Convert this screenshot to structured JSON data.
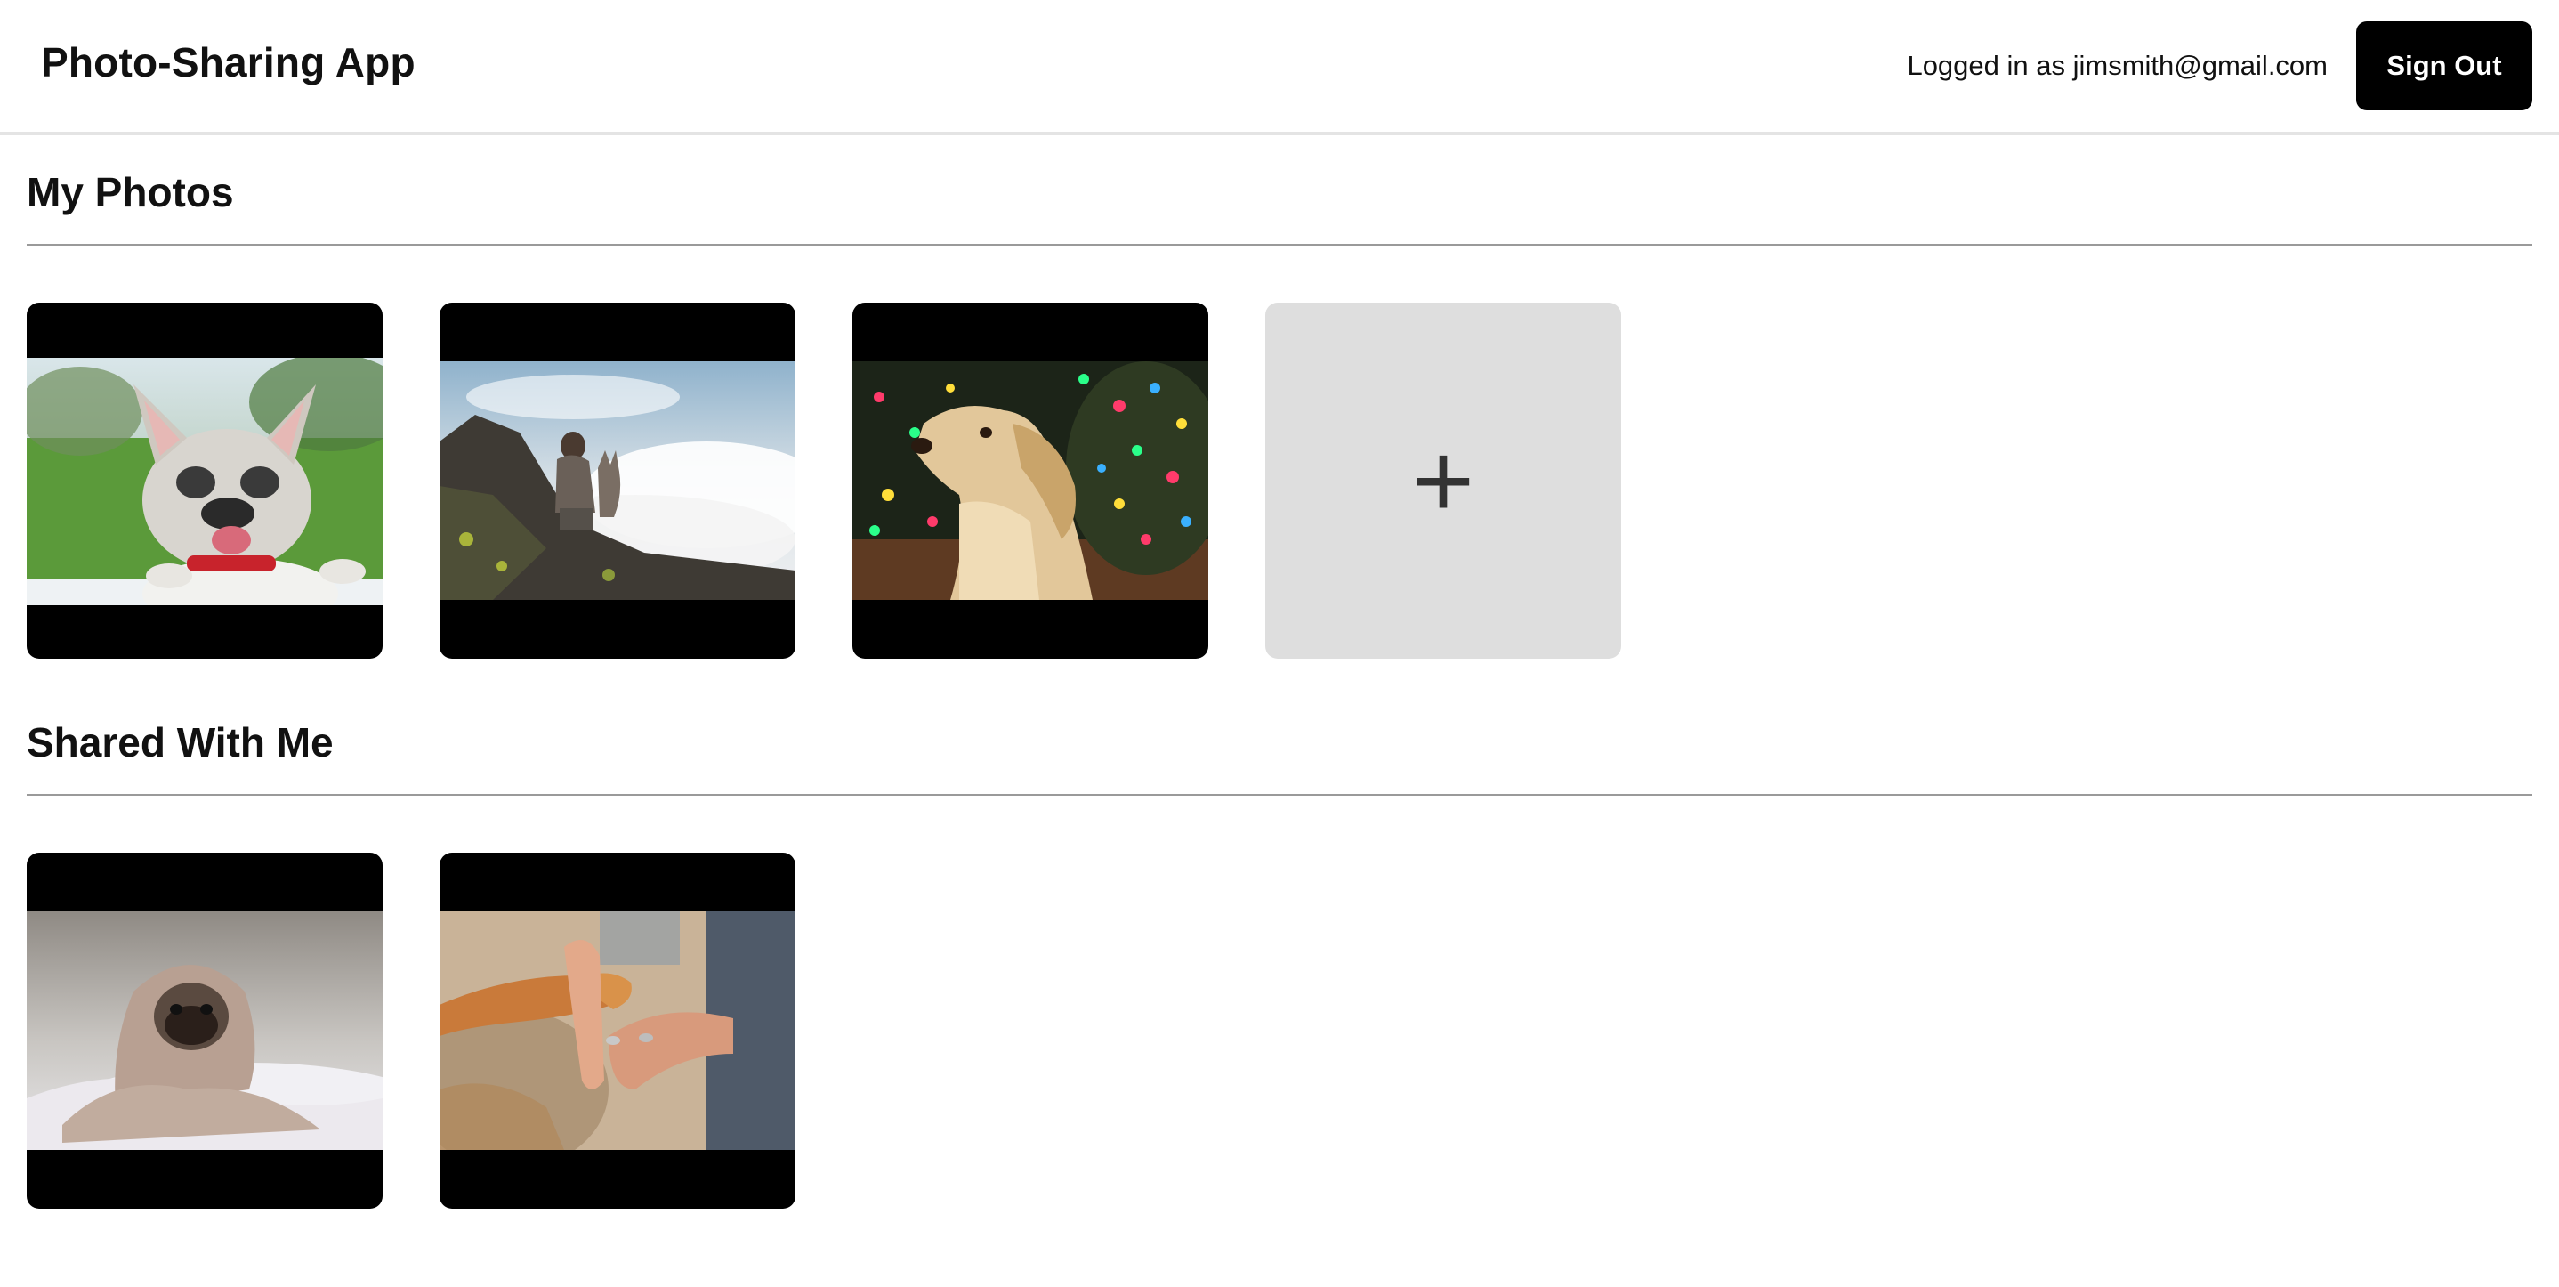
{
  "header": {
    "title": "Photo-Sharing App",
    "login_text": "Logged in as jimsmith@gmail.com",
    "signout_label": "Sign Out"
  },
  "my_photos": {
    "title": "My Photos",
    "items": [
      {
        "icon": "french-bulldog-photo"
      },
      {
        "icon": "woman-with-dog-on-mountain-photo"
      },
      {
        "icon": "golden-retriever-with-lights-photo"
      }
    ],
    "add_label": "+"
  },
  "shared": {
    "title": "Shared With Me",
    "items": [
      {
        "icon": "pug-in-blanket-photo"
      },
      {
        "icon": "dog-paw-and-hands-photo"
      }
    ]
  },
  "colors": {
    "accent": "#000000",
    "add_tile": "#dedede",
    "divider": "#9a9a9a"
  }
}
